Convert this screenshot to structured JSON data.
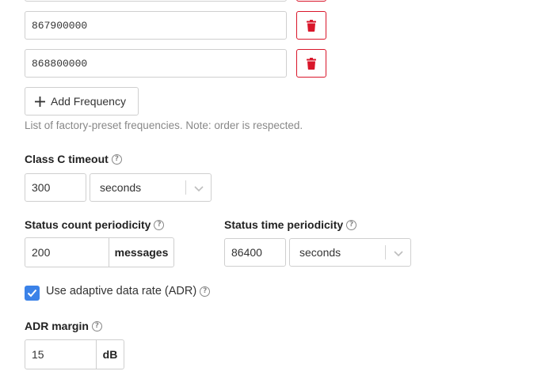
{
  "frequencies": {
    "items": [
      {
        "value": "867900000"
      },
      {
        "value": "868800000"
      }
    ],
    "add_label": "Add Frequency",
    "hint": "List of factory-preset frequencies. Note: order is respected."
  },
  "class_c_timeout": {
    "label": "Class C timeout",
    "value": "300",
    "unit": "seconds"
  },
  "status_count": {
    "label": "Status count periodicity",
    "value": "200",
    "unit": "messages"
  },
  "status_time": {
    "label": "Status time periodicity",
    "value": "86400",
    "unit": "seconds"
  },
  "adr": {
    "label": "Use adaptive data rate (ADR)",
    "checked": true
  },
  "adr_margin": {
    "label": "ADR margin",
    "value": "15",
    "unit": "dB"
  },
  "colors": {
    "danger": "#d9162a",
    "accent": "#3b82e8",
    "border": "#cfcfcf",
    "hint": "#888888"
  }
}
